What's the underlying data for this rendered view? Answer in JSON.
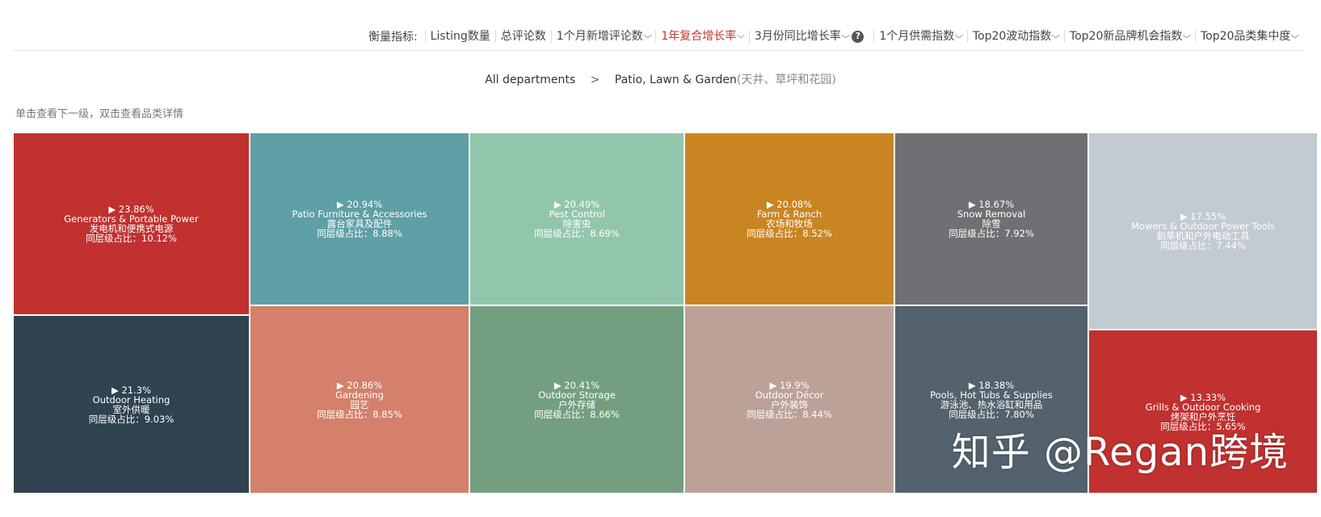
{
  "toolbar": {
    "label": "衡量指标:",
    "metrics": [
      {
        "label": "Listing数量",
        "dropdown": false,
        "active": false
      },
      {
        "label": "总评论数",
        "dropdown": false,
        "active": false
      },
      {
        "label": "1个月新增评论数",
        "dropdown": true,
        "active": false
      },
      {
        "label": "1年复合增长率",
        "dropdown": true,
        "active": true
      },
      {
        "label": "3月份同比增长率",
        "dropdown": true,
        "active": false,
        "help": true
      },
      {
        "label": "1个月供需指数",
        "dropdown": true,
        "active": false
      },
      {
        "label": "Top20波动指数",
        "dropdown": true,
        "active": false
      },
      {
        "label": "Top20新品牌机会指数",
        "dropdown": true,
        "active": false
      },
      {
        "label": "Top20品类集中度",
        "dropdown": true,
        "active": false
      }
    ],
    "help_icon": "question-icon",
    "help_glyph": "?"
  },
  "breadcrumb": {
    "root": "All departments",
    "separator": ">",
    "current": "Patio, Lawn & Garden",
    "current_sub": "(天井、草坪和花园)"
  },
  "hint": "单击查看下一级，双击查看品类详情",
  "watermark": "知乎 @Regan跨境",
  "chart_data": {
    "type": "treemap",
    "metric": "1年复合增长率",
    "share_label": "同层级占比",
    "items": [
      {
        "name": "Generators & Portable Power",
        "name_cn": "发电机和便携式电源",
        "growth": "▶ 23.86%",
        "share": 10.12,
        "share_text": "同层级占比：10.12%",
        "color": "#c0312f"
      },
      {
        "name": "Outdoor Heating",
        "name_cn": "室外供暖",
        "growth": "▶ 21.3%",
        "share": 9.03,
        "share_text": "同层级占比：9.03%",
        "color": "#2f4250"
      },
      {
        "name": "Patio Furniture & Accessories",
        "name_cn": "露台家具及配件",
        "growth": "▶ 20.94%",
        "share": 8.88,
        "share_text": "同层级占比：8.88%",
        "color": "#5f9fa6"
      },
      {
        "name": "Gardening",
        "name_cn": "园艺",
        "growth": "▶ 20.86%",
        "share": 8.85,
        "share_text": "同层级占比：8.85%",
        "color": "#d4806a"
      },
      {
        "name": "Pest Control",
        "name_cn": "除害虫",
        "growth": "▶ 20.49%",
        "share": 8.69,
        "share_text": "同层级占比：8.69%",
        "color": "#92c6ac"
      },
      {
        "name": "Outdoor Storage",
        "name_cn": "户外存储",
        "growth": "▶ 20.41%",
        "share": 8.66,
        "share_text": "同层级占比：8.66%",
        "color": "#739f80"
      },
      {
        "name": "Farm & Ranch",
        "name_cn": "农场和牧场",
        "growth": "▶ 20.08%",
        "share": 8.52,
        "share_text": "同层级占比：8.52%",
        "color": "#c98521"
      },
      {
        "name": "Outdoor Décor",
        "name_cn": "户外装饰",
        "growth": "▶ 19.9%",
        "share": 8.44,
        "share_text": "同层级占比：8.44%",
        "color": "#bca198"
      },
      {
        "name": "Snow Removal",
        "name_cn": "除雪",
        "growth": "▶ 18.67%",
        "share": 7.92,
        "share_text": "同层级占比：7.92%",
        "color": "#6f7073"
      },
      {
        "name": "Pools, Hot Tubs & Supplies",
        "name_cn": "游泳池、热水浴缸和用品",
        "growth": "▶ 18.38%",
        "share": 7.8,
        "share_text": "同层级占比：7.80%",
        "color": "#53626d"
      },
      {
        "name": "Mowers & Outdoor Power Tools",
        "name_cn": "割草机和户外电动工具",
        "growth": "▶ 17.55%",
        "share": 7.44,
        "share_text": "同层级占比：7.44%",
        "color": "#c3cad1"
      },
      {
        "name": "Grills & Outdoor Cooking",
        "name_cn": "烤架和户外烹饪",
        "growth": "▶ 13.33%",
        "share": 5.65,
        "share_text": "同层级占比：5.65%",
        "color": "#c0312f"
      }
    ]
  }
}
